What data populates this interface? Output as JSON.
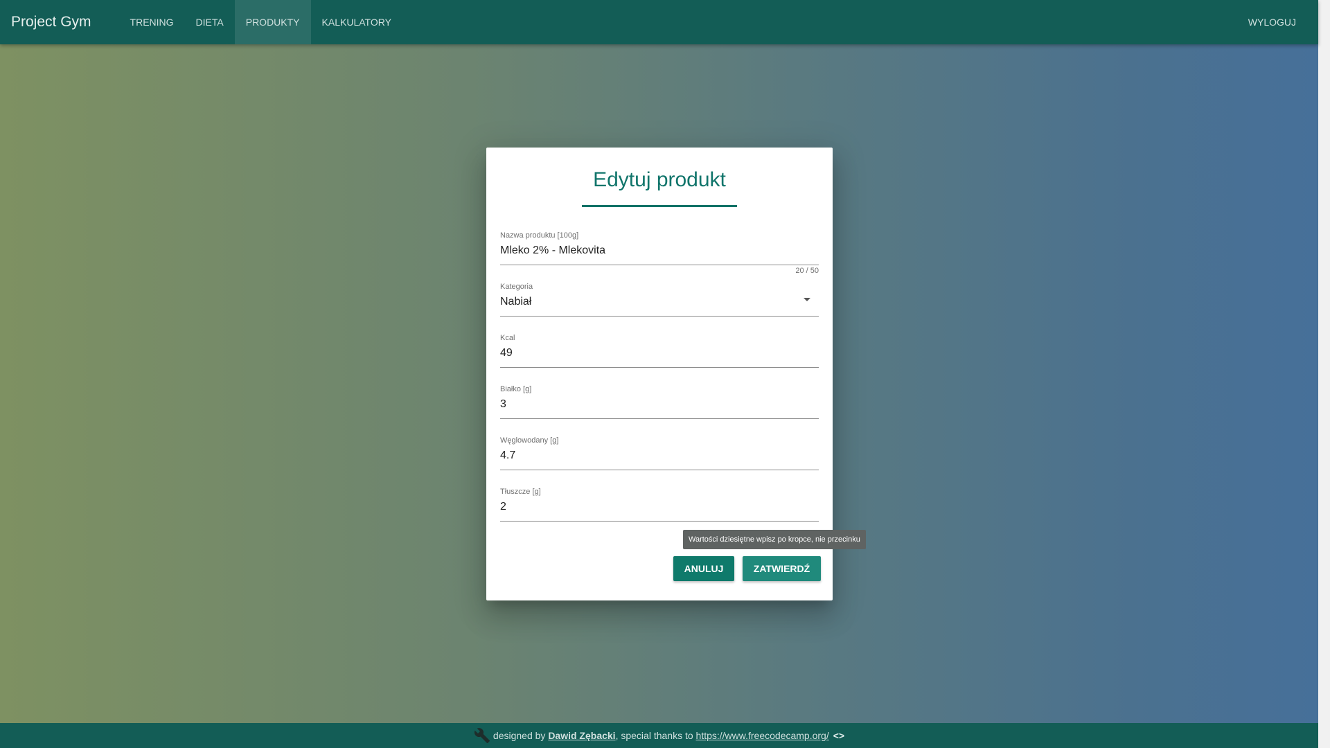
{
  "navbar": {
    "brand": "Project Gym",
    "items": [
      {
        "label": "TRENING"
      },
      {
        "label": "DIETA"
      },
      {
        "label": "PRODUKTY",
        "active": true
      },
      {
        "label": "KALKULATORY"
      }
    ],
    "logout": "WYLOGUJ"
  },
  "modal": {
    "title": "Edytuj produkt",
    "fields": {
      "name": {
        "label": "Nazwa produktu [100g]",
        "value": "Mleko 2% - Mlekovita",
        "counter": "20 / 50"
      },
      "category": {
        "label": "Kategoria",
        "value": "Nabiał"
      },
      "kcal": {
        "label": "Kcal",
        "value": "49"
      },
      "protein": {
        "label": "Białko [g]",
        "value": "3"
      },
      "carbs": {
        "label": "Węglowodany [g]",
        "value": "4.7"
      },
      "fat": {
        "label": "Tłuszcze [g]",
        "value": "2"
      }
    },
    "tooltip": "Wartości dziesiętne wpisz po kropce, nie przecinku",
    "cancel_label": "ANULUJ",
    "confirm_label": "ZATWIERDŹ"
  },
  "footer": {
    "prefix": "designed by",
    "author": "Dawid Zębacki",
    "middle": ", special thanks to",
    "link": "https://www.freecodecamp.org/",
    "code_symbol": "<>"
  },
  "colors": {
    "primary": "#135d56",
    "accent": "#11756b"
  }
}
